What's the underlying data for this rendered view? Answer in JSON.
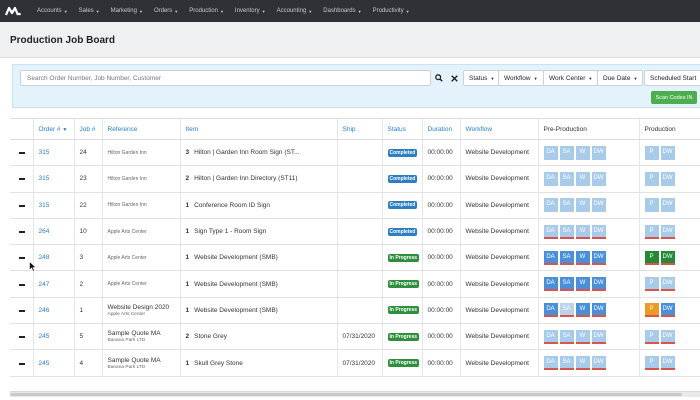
{
  "navbar": {
    "logo": "logo-icon",
    "items": [
      "Accounts",
      "Sales",
      "Marketing",
      "Orders",
      "Production",
      "Inventory",
      "Accounting",
      "Dashboards",
      "Productivity"
    ]
  },
  "page": {
    "title": "Production Job Board"
  },
  "filters": {
    "search_placeholder": "Search Order Number, Job Number, Customer",
    "status": "Status",
    "workflow": "Workflow",
    "work_center": "Work Center",
    "due_date": "Due Date",
    "scheduled_start": "Scheduled Start",
    "scan_codes": "Scan Codes IN"
  },
  "table": {
    "headers": {
      "order": "Order #",
      "job": "Job #",
      "reference": "Reference",
      "item": "Item",
      "ship": "Ship",
      "status": "Status",
      "duration": "Duration",
      "workflow": "Workflow",
      "preproduction": "Pre-Production",
      "production": "Production"
    },
    "rows": [
      {
        "order": "315",
        "job": "24",
        "ref": "Hilton Garden Inn",
        "ref_sub": "",
        "qty": "3",
        "item": "Hilton | Garden Inn Room Sign (ST...",
        "ship": "",
        "status": "Completed",
        "duration": "00:00:00",
        "workflow": "Website Development"
      },
      {
        "order": "315",
        "job": "23",
        "ref": "Hilton Garden Inn",
        "ref_sub": "",
        "qty": "2",
        "item": "Hilton | Garden Inn Directory (ST11)",
        "ship": "",
        "status": "Completed",
        "duration": "00:00:00",
        "workflow": "Website Development"
      },
      {
        "order": "315",
        "job": "22",
        "ref": "Hilton Garden Inn",
        "ref_sub": "",
        "qty": "1",
        "item": "Conference Room ID Sign",
        "ship": "",
        "status": "Completed",
        "duration": "00:00:00",
        "workflow": "Website Development"
      },
      {
        "order": "264",
        "job": "10",
        "ref": "Apple Arts Center",
        "ref_sub": "",
        "qty": "1",
        "item": "Sign Type 1 - Room Sign",
        "ship": "",
        "status": "Completed",
        "duration": "00:00:00",
        "workflow": "Website Development"
      },
      {
        "order": "248",
        "job": "3",
        "ref": "Apple Arts Center",
        "ref_sub": "",
        "qty": "1",
        "item": "Website Development (SMB)",
        "ship": "",
        "status": "In Progress",
        "duration": "00:00:00",
        "workflow": "Website Development"
      },
      {
        "order": "247",
        "job": "2",
        "ref": "Apple Arts Center",
        "ref_sub": "",
        "qty": "1",
        "item": "Website Development (SMB)",
        "ship": "",
        "status": "In Progress",
        "duration": "00:00:00",
        "workflow": "Website Development"
      },
      {
        "order": "246",
        "job": "1",
        "ref": "Website Design 2020",
        "ref_sub": "Apple Arts Center",
        "qty": "1",
        "item": "Website Development (SMB)",
        "ship": "",
        "status": "In Progress",
        "duration": "00:00:00",
        "workflow": "Website Development"
      },
      {
        "order": "245",
        "job": "5",
        "ref": "Sample Quote MA",
        "ref_sub": "Banana Park LTD",
        "qty": "2",
        "item": "Stone Grey",
        "ship": "07/31/2020",
        "status": "In Progress",
        "duration": "00:00:00",
        "workflow": "Website Development"
      },
      {
        "order": "245",
        "job": "4",
        "ref": "Sample Quote MA",
        "ref_sub": "Banana Park LTD",
        "qty": "1",
        "item": "Skull Grey Stone",
        "ship": "07/31/2020",
        "status": "In Progress",
        "duration": "00:00:00",
        "workflow": "Website Development"
      }
    ],
    "stage_labels": {
      "da": "DA",
      "sa": "SA",
      "w": "W",
      "dw": "DW",
      "p": "P"
    }
  },
  "colors": {
    "navbar": "#2f3136",
    "link": "#2a7fc9",
    "completed": "#2e7fc2",
    "in_progress": "#2f8f3e",
    "stage_active": "#4a90d9",
    "stage_inactive": "#a9cbea",
    "stage_green": "#238a33",
    "stage_orange": "#ef9a23",
    "underline_red": "#d9534f"
  }
}
